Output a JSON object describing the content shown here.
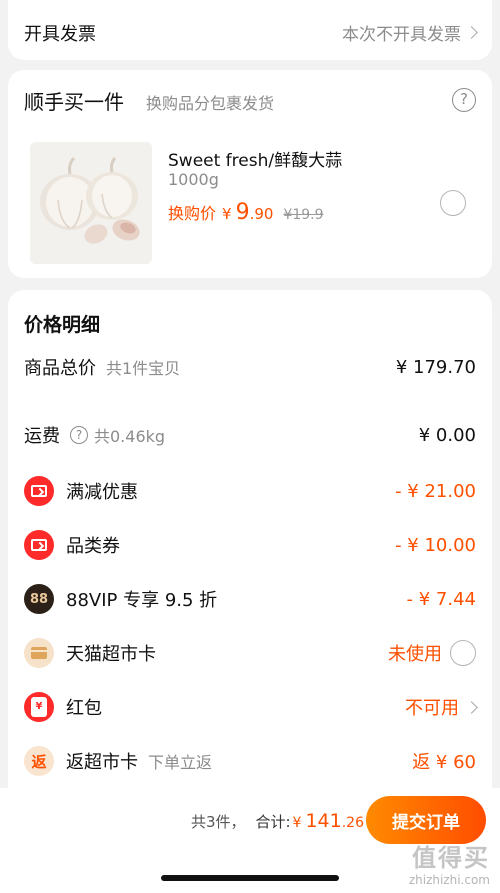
{
  "invoice": {
    "label": "开具发票",
    "value": "本次不开具发票"
  },
  "addon": {
    "title": "顺手买一件",
    "subtitle": "换购品分包裹发货",
    "help_icon": "question-circle-icon",
    "product": {
      "name": "Sweet fresh/鲜馥大蒜",
      "spec": "1000g",
      "price_label": "换购价",
      "currency": "¥",
      "price_int": "9",
      "price_dec": ".90",
      "original_price": "¥19.9"
    }
  },
  "price_detail": {
    "title": "价格明细",
    "rows": [
      {
        "label": "商品总价",
        "note": "共1件宝贝",
        "value": "¥ 179.70"
      },
      {
        "label": "运费",
        "note": "共0.46kg",
        "value": "¥ 0.00"
      },
      {
        "label": "满减优惠",
        "value": "- ¥ 21.00",
        "icon": "coupon-icon"
      },
      {
        "label": "品类券",
        "value": "- ¥ 10.00",
        "icon": "coupon-icon"
      },
      {
        "label": "88VIP 专享 9.5 折",
        "value": "- ¥ 7.44",
        "icon": "88vip-icon",
        "icon_text": "88"
      },
      {
        "label": "天猫超市卡",
        "value": "未使用",
        "icon": "card-icon"
      },
      {
        "label": "红包",
        "value": "不可用",
        "icon": "red-packet-icon"
      },
      {
        "label": "返超市卡",
        "note": "下单立返",
        "value": "返 ¥ 60",
        "icon": "fan-icon",
        "icon_text": "返"
      }
    ]
  },
  "footer": {
    "count": "共3件，",
    "sum_label": "合计:",
    "currency": "¥",
    "total_int": "141",
    "total_dec": ".26",
    "submit_label": "提交订单"
  },
  "watermark": {
    "big": "值得买",
    "small": "zhizhizhi.com"
  },
  "colors": {
    "accent": "#ff5000",
    "red": "#ff2a2a"
  }
}
